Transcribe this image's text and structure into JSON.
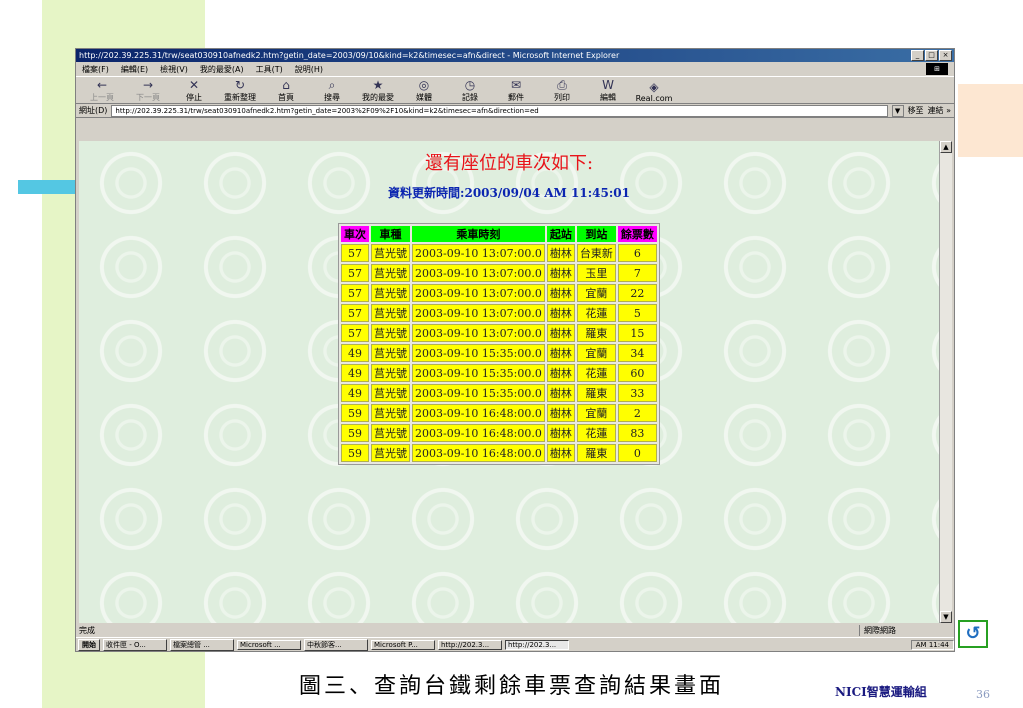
{
  "window": {
    "title": "http://202.39.225.31/trw/seat030910afnedk2.htm?getin_date=2003/09/10&kind=k2&timesec=afn&direct - Microsoft Internet Explorer"
  },
  "menu": [
    "檔案(F)",
    "編輯(E)",
    "檢視(V)",
    "我的最愛(A)",
    "工具(T)",
    "說明(H)"
  ],
  "toolbar": [
    {
      "label": "上一頁",
      "icon": "←"
    },
    {
      "label": "下一頁",
      "icon": "→"
    },
    {
      "label": "停止",
      "icon": "✕"
    },
    {
      "label": "重新整理",
      "icon": "↻"
    },
    {
      "label": "首頁",
      "icon": "⌂"
    },
    {
      "label": "搜尋",
      "icon": "⌕"
    },
    {
      "label": "我的最愛",
      "icon": "★"
    },
    {
      "label": "媒體",
      "icon": "◎"
    },
    {
      "label": "記錄",
      "icon": "◷"
    },
    {
      "label": "郵件",
      "icon": "✉"
    },
    {
      "label": "列印",
      "icon": "⎙"
    },
    {
      "label": "編輯",
      "icon": "W"
    },
    {
      "label": "Real.com",
      "icon": "◈"
    }
  ],
  "address": {
    "label": "網址(D)",
    "url": "http://202.39.225.31/trw/seat030910afnedk2.htm?getin_date=2003%2F09%2F10&kind=k2&timesec=afn&direction=ed",
    "go": "移至",
    "links": "連結 »"
  },
  "page": {
    "heading": "還有座位的車次如下:",
    "updated": "資料更新時間:2003/09/04 AM 11:45:01",
    "columns": [
      "車次",
      "車種",
      "乘車時刻",
      "起站",
      "到站",
      "餘票數"
    ],
    "rows": [
      [
        "57",
        "莒光號",
        "2003-09-10 13:07:00.0",
        "樹林",
        "台東新",
        "6"
      ],
      [
        "57",
        "莒光號",
        "2003-09-10 13:07:00.0",
        "樹林",
        "玉里",
        "7"
      ],
      [
        "57",
        "莒光號",
        "2003-09-10 13:07:00.0",
        "樹林",
        "宜蘭",
        "22"
      ],
      [
        "57",
        "莒光號",
        "2003-09-10 13:07:00.0",
        "樹林",
        "花蓮",
        "5"
      ],
      [
        "57",
        "莒光號",
        "2003-09-10 13:07:00.0",
        "樹林",
        "羅東",
        "15"
      ],
      [
        "49",
        "莒光號",
        "2003-09-10 15:35:00.0",
        "樹林",
        "宜蘭",
        "34"
      ],
      [
        "49",
        "莒光號",
        "2003-09-10 15:35:00.0",
        "樹林",
        "花蓮",
        "60"
      ],
      [
        "49",
        "莒光號",
        "2003-09-10 15:35:00.0",
        "樹林",
        "羅東",
        "33"
      ],
      [
        "59",
        "莒光號",
        "2003-09-10 16:48:00.0",
        "樹林",
        "宜蘭",
        "2"
      ],
      [
        "59",
        "莒光號",
        "2003-09-10 16:48:00.0",
        "樹林",
        "花蓮",
        "83"
      ],
      [
        "59",
        "莒光號",
        "2003-09-10 16:48:00.0",
        "樹林",
        "羅東",
        "0"
      ]
    ]
  },
  "status": {
    "text": "完成",
    "zone": "網際網路"
  },
  "taskbar": {
    "start": "開始",
    "tasks": [
      "收件匣 - O...",
      "檔案總管 ...",
      "Microsoft ...",
      "中秋節客...",
      "Microsoft P...",
      "http://202.3...",
      "http://202.3..."
    ],
    "clock": "AM 11:44"
  },
  "slide": {
    "caption": "圖三、查詢台鐵剩餘車票查詢結果畫面",
    "org": "NICI智慧運輸組",
    "page_number": "36"
  },
  "colors": {
    "header_green": "#00ff00",
    "header_magenta": "#ff00ff",
    "cell_yellow": "#ffff00",
    "heading_red": "#e8141a",
    "title_blue": "#0a246a"
  }
}
